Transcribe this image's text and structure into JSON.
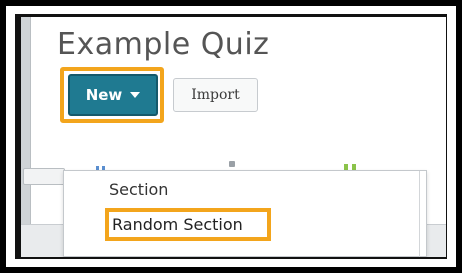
{
  "page": {
    "title": "Example Quiz"
  },
  "toolbar": {
    "new_label": "New",
    "import_label": "Import"
  },
  "dropdown": {
    "items": [
      {
        "label": "Section"
      },
      {
        "label": "Random Section"
      }
    ]
  },
  "colors": {
    "highlight": "#f3a51c",
    "primary_button": "#1f7a91"
  },
  "icons": [
    "chevron-down-icon"
  ]
}
